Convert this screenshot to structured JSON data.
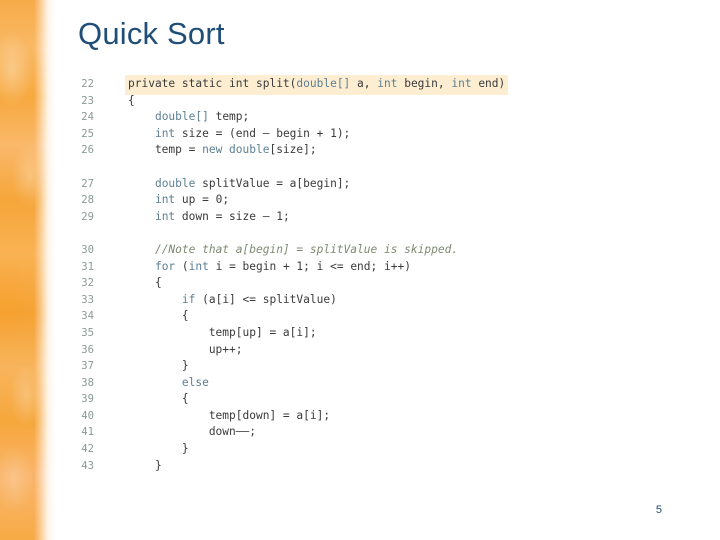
{
  "slide": {
    "title": "Quick Sort",
    "number": "5",
    "accent_color": "#1f4e79",
    "band_color": "#f7ab4a",
    "highlight_color": "#fdeed2",
    "keyword_color": "#5d7f93",
    "comment_color": "#7e8b72",
    "line_number_color": "#8a9a94"
  },
  "code": {
    "language": "java",
    "lines": [
      {
        "number": "22",
        "highlight": true,
        "gap_before": false,
        "tokens": [
          {
            "t": "private static int ",
            "c": "pl"
          },
          {
            "t": "split(",
            "c": "pl"
          },
          {
            "t": "double[]",
            "c": "kw"
          },
          {
            "t": " a, ",
            "c": "pl"
          },
          {
            "t": "int",
            "c": "kw"
          },
          {
            "t": " begin, ",
            "c": "pl"
          },
          {
            "t": "int",
            "c": "kw"
          },
          {
            "t": " end)",
            "c": "pl"
          }
        ],
        "text": "private static int split(double[] a, int begin, int end)"
      },
      {
        "number": "23",
        "highlight": false,
        "gap_before": false,
        "tokens": [
          {
            "t": "{",
            "c": "pl"
          }
        ],
        "text": "{"
      },
      {
        "number": "24",
        "highlight": false,
        "gap_before": false,
        "tokens": [
          {
            "t": "    ",
            "c": "pl"
          },
          {
            "t": "double[]",
            "c": "kw"
          },
          {
            "t": " temp;",
            "c": "pl"
          }
        ],
        "text": "    double[] temp;"
      },
      {
        "number": "25",
        "highlight": false,
        "gap_before": false,
        "tokens": [
          {
            "t": "    ",
            "c": "pl"
          },
          {
            "t": "int",
            "c": "kw"
          },
          {
            "t": " size = (end – begin + 1);",
            "c": "pl"
          }
        ],
        "text": "    int size = (end - begin + 1);"
      },
      {
        "number": "26",
        "highlight": false,
        "gap_before": false,
        "tokens": [
          {
            "t": "    temp = ",
            "c": "pl"
          },
          {
            "t": "new double",
            "c": "kw"
          },
          {
            "t": "[size];",
            "c": "pl"
          }
        ],
        "text": "    temp = new double[size];"
      },
      {
        "number": "27",
        "highlight": false,
        "gap_before": true,
        "tokens": [
          {
            "t": "    ",
            "c": "pl"
          },
          {
            "t": "double",
            "c": "kw"
          },
          {
            "t": " splitValue = a[begin];",
            "c": "pl"
          }
        ],
        "text": "    double splitValue = a[begin];"
      },
      {
        "number": "28",
        "highlight": false,
        "gap_before": false,
        "tokens": [
          {
            "t": "    ",
            "c": "pl"
          },
          {
            "t": "int",
            "c": "kw"
          },
          {
            "t": " up = 0;",
            "c": "pl"
          }
        ],
        "text": "    int up = 0;"
      },
      {
        "number": "29",
        "highlight": false,
        "gap_before": false,
        "tokens": [
          {
            "t": "    ",
            "c": "pl"
          },
          {
            "t": "int",
            "c": "kw"
          },
          {
            "t": " down = size – 1;",
            "c": "pl"
          }
        ],
        "text": "    int down = size - 1;"
      },
      {
        "number": "30",
        "highlight": false,
        "gap_before": true,
        "tokens": [
          {
            "t": "    ",
            "c": "pl"
          },
          {
            "t": "//Note that a[begin] = splitValue is skipped.",
            "c": "cm"
          }
        ],
        "text": "    //Note that a[begin] = splitValue is skipped."
      },
      {
        "number": "31",
        "highlight": false,
        "gap_before": false,
        "tokens": [
          {
            "t": "    ",
            "c": "pl"
          },
          {
            "t": "for",
            "c": "kw"
          },
          {
            "t": " (",
            "c": "pl"
          },
          {
            "t": "int",
            "c": "kw"
          },
          {
            "t": " i = begin + 1; i <= end; i++)",
            "c": "pl"
          }
        ],
        "text": "    for (int i = begin + 1; i <= end; i++)"
      },
      {
        "number": "32",
        "highlight": false,
        "gap_before": false,
        "tokens": [
          {
            "t": "    {",
            "c": "pl"
          }
        ],
        "text": "    {"
      },
      {
        "number": "33",
        "highlight": false,
        "gap_before": false,
        "tokens": [
          {
            "t": "        ",
            "c": "pl"
          },
          {
            "t": "if",
            "c": "kw"
          },
          {
            "t": " (a[i] <= splitValue)",
            "c": "pl"
          }
        ],
        "text": "        if (a[i] <= splitValue)"
      },
      {
        "number": "34",
        "highlight": false,
        "gap_before": false,
        "tokens": [
          {
            "t": "        {",
            "c": "pl"
          }
        ],
        "text": "        {"
      },
      {
        "number": "35",
        "highlight": false,
        "gap_before": false,
        "tokens": [
          {
            "t": "            temp[up] = a[i];",
            "c": "pl"
          }
        ],
        "text": "            temp[up] = a[i];"
      },
      {
        "number": "36",
        "highlight": false,
        "gap_before": false,
        "tokens": [
          {
            "t": "            up++;",
            "c": "pl"
          }
        ],
        "text": "            up++;"
      },
      {
        "number": "37",
        "highlight": false,
        "gap_before": false,
        "tokens": [
          {
            "t": "        }",
            "c": "pl"
          }
        ],
        "text": "        }"
      },
      {
        "number": "38",
        "highlight": false,
        "gap_before": false,
        "tokens": [
          {
            "t": "        ",
            "c": "pl"
          },
          {
            "t": "else",
            "c": "kw"
          }
        ],
        "text": "        else"
      },
      {
        "number": "39",
        "highlight": false,
        "gap_before": false,
        "tokens": [
          {
            "t": "        {",
            "c": "pl"
          }
        ],
        "text": "        {"
      },
      {
        "number": "40",
        "highlight": false,
        "gap_before": false,
        "tokens": [
          {
            "t": "            temp[down] = a[i];",
            "c": "pl"
          }
        ],
        "text": "            temp[down] = a[i];"
      },
      {
        "number": "41",
        "highlight": false,
        "gap_before": false,
        "tokens": [
          {
            "t": "            down––;",
            "c": "pl"
          }
        ],
        "text": "            down--;"
      },
      {
        "number": "42",
        "highlight": false,
        "gap_before": false,
        "tokens": [
          {
            "t": "        }",
            "c": "pl"
          }
        ],
        "text": "        }"
      },
      {
        "number": "43",
        "highlight": false,
        "gap_before": false,
        "tokens": [
          {
            "t": "    }",
            "c": "pl"
          }
        ],
        "text": "    }"
      }
    ]
  }
}
